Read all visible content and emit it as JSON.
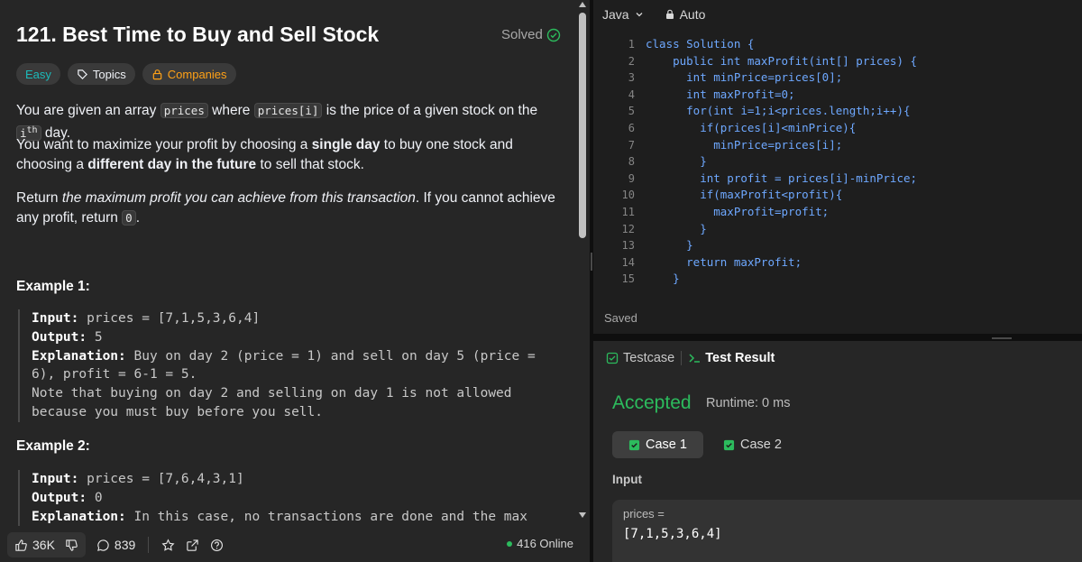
{
  "problem": {
    "title": "121. Best Time to Buy and Sell Stock",
    "solved_label": "Solved",
    "tags": {
      "difficulty": "Easy",
      "topics": "Topics",
      "companies": "Companies"
    },
    "p1": {
      "a": "You are given an array ",
      "b": "prices",
      "c": " where ",
      "d": "prices[i]",
      "e": " is the price of a given stock on the ",
      "f": "i",
      "g": "th",
      "h": " day."
    },
    "p2": {
      "a": "You want to maximize your profit by choosing a ",
      "b": "single day",
      "c": " to buy one stock and choosing a ",
      "d": "different day in the future",
      "e": " to sell that stock."
    },
    "p3": {
      "a": "Return ",
      "b": "the maximum profit you can achieve from this transaction",
      "c": ". If you cannot achieve any profit, return ",
      "d": "0",
      "e": "."
    },
    "example1": {
      "title": "Example 1:",
      "input_label": "Input:",
      "input_value": " prices = [7,1,5,3,6,4]",
      "output_label": "Output:",
      "output_value": " 5",
      "explanation_label": "Explanation:",
      "explanation_value": " Buy on day 2 (price = 1) and sell on day 5 (price = 6), profit = 6-1 = 5.",
      "note": "Note that buying on day 2 and selling on day 1 is not allowed because you must buy before you sell."
    },
    "example2": {
      "title": "Example 2:",
      "input_label": "Input:",
      "input_value": " prices = [7,6,4,3,1]",
      "output_label": "Output:",
      "output_value": " 0",
      "explanation_label": "Explanation:",
      "explanation_value": " In this case, no transactions are done and the max"
    }
  },
  "footer": {
    "likes": "36K",
    "comments": "839",
    "online": "416 Online"
  },
  "editor": {
    "language": "Java",
    "mode": "Auto",
    "line_numbers": [
      "1",
      "2",
      "3",
      "4",
      "5",
      "6",
      "7",
      "8",
      "9",
      "10",
      "11",
      "12",
      "13",
      "14",
      "15"
    ],
    "code_lines": [
      "class Solution {",
      "    public int maxProfit(int[] prices) {",
      "      int minPrice=prices[0];",
      "      int maxProfit=0;",
      "      for(int i=1;i<prices.length;i++){",
      "        if(prices[i]<minPrice){",
      "          minPrice=prices[i];",
      "        }",
      "        int profit = prices[i]-minPrice;",
      "        if(maxProfit<profit){",
      "          maxProfit=profit;",
      "        }",
      "      }",
      "      return maxProfit;",
      "    }"
    ],
    "status": "Saved"
  },
  "tests": {
    "tab_testcase": "Testcase",
    "tab_result": "Test Result",
    "verdict": "Accepted",
    "runtime": "Runtime: 0 ms",
    "case1": "Case 1",
    "case2": "Case 2",
    "input_label": "Input",
    "input_name": "prices =",
    "input_value": "[7,1,5,3,6,4]"
  },
  "colors": {
    "accepted": "#2cbb5d",
    "companies": "#ffa116",
    "easy": "#1cbaba",
    "code": "#6ea8ff"
  }
}
